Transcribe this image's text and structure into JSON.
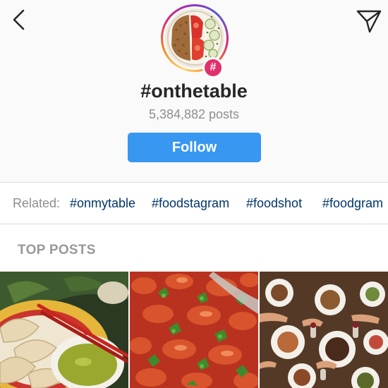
{
  "header": {
    "hashtag": "#onthetable",
    "post_count": "5,384,882 posts",
    "follow_label": "Follow",
    "badge_symbol": "#"
  },
  "icons": {
    "back": "chevron-left-icon",
    "share": "paper-plane-icon",
    "badge": "hashtag-icon"
  },
  "related": {
    "label": "Related:",
    "tags": [
      "#onmytable",
      "#foodstagram",
      "#foodshot",
      "#foodgram"
    ]
  },
  "top_posts": {
    "heading": "TOP POSTS"
  },
  "colors": {
    "follow_button": "#3897f0",
    "related_tag": "#003569",
    "badge": "#e1306c",
    "muted_text": "#8e8e8e"
  }
}
